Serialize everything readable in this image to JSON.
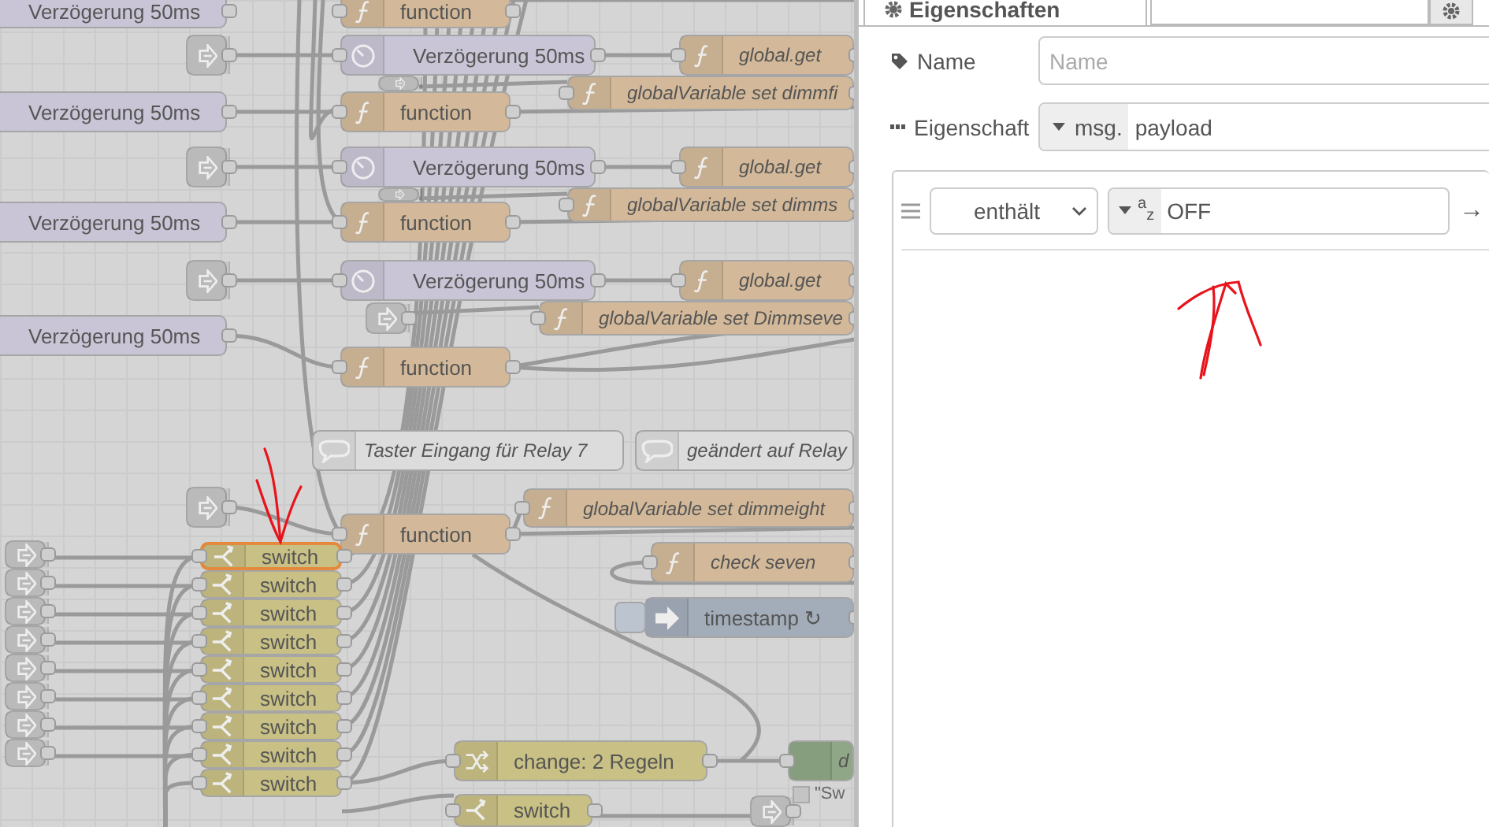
{
  "canvas": {
    "nodes": [
      {
        "kind": "delay",
        "label": "Verzögerung 50ms",
        "italic": false,
        "selected": false
      },
      {
        "kind": "function",
        "label": "function",
        "italic": false,
        "selected": false
      },
      {
        "kind": "link",
        "selected": false
      },
      {
        "kind": "delay",
        "label": "Verzögerung 50ms",
        "italic": false,
        "selected": false
      },
      {
        "kind": "function",
        "label": "global.get",
        "italic": true,
        "selected": false
      },
      {
        "kind": "link",
        "selected": false
      },
      {
        "kind": "function",
        "label": "globalVariable set dimmfi",
        "italic": true,
        "selected": false
      },
      {
        "kind": "delay",
        "label": "Verzögerung 50ms",
        "italic": false,
        "selected": false
      },
      {
        "kind": "function",
        "label": "function",
        "italic": false,
        "selected": false
      },
      {
        "kind": "link",
        "selected": false
      },
      {
        "kind": "delay",
        "label": "Verzögerung 50ms",
        "italic": false,
        "selected": false
      },
      {
        "kind": "function",
        "label": "global.get",
        "italic": true,
        "selected": false
      },
      {
        "kind": "link",
        "selected": false
      },
      {
        "kind": "function",
        "label": "globalVariable set dimms",
        "italic": true,
        "selected": false
      },
      {
        "kind": "delay",
        "label": "Verzögerung 50ms",
        "italic": false,
        "selected": false
      },
      {
        "kind": "function",
        "label": "function",
        "italic": false,
        "selected": false
      },
      {
        "kind": "link",
        "selected": false
      },
      {
        "kind": "delay",
        "label": "Verzögerung 50ms",
        "italic": false,
        "selected": false
      },
      {
        "kind": "function",
        "label": "global.get",
        "italic": true,
        "selected": false
      },
      {
        "kind": "link",
        "selected": false
      },
      {
        "kind": "function",
        "label": "globalVariable set Dimmseve",
        "italic": true,
        "selected": false
      },
      {
        "kind": "delay",
        "label": "Verzögerung 50ms",
        "italic": false,
        "selected": false
      },
      {
        "kind": "function",
        "label": "function",
        "italic": false,
        "selected": false
      },
      {
        "kind": "comment",
        "label": "Taster Eingang für Relay 7",
        "italic": true,
        "selected": false
      },
      {
        "kind": "comment",
        "label": "geändert auf Relay",
        "italic": true,
        "selected": false
      },
      {
        "kind": "link",
        "selected": false
      },
      {
        "kind": "function",
        "label": "globalVariable set dimmeight",
        "italic": true,
        "selected": false
      },
      {
        "kind": "function",
        "label": "function",
        "italic": false,
        "selected": false
      },
      {
        "kind": "function",
        "label": "check seven",
        "italic": true,
        "selected": false
      },
      {
        "kind": "inject",
        "label": "timestamp ↻",
        "italic": false,
        "selected": false
      },
      {
        "kind": "link",
        "selected": false
      },
      {
        "kind": "link",
        "selected": false
      },
      {
        "kind": "link",
        "selected": false
      },
      {
        "kind": "link",
        "selected": false
      },
      {
        "kind": "link",
        "selected": false
      },
      {
        "kind": "link",
        "selected": false
      },
      {
        "kind": "link",
        "selected": false
      },
      {
        "kind": "link",
        "selected": false
      },
      {
        "kind": "switch",
        "label": "switch",
        "italic": false,
        "selected": true
      },
      {
        "kind": "switch",
        "label": "switch",
        "italic": false,
        "selected": false
      },
      {
        "kind": "switch",
        "label": "switch",
        "italic": false,
        "selected": false
      },
      {
        "kind": "switch",
        "label": "switch",
        "italic": false,
        "selected": false
      },
      {
        "kind": "switch",
        "label": "switch",
        "italic": false,
        "selected": false
      },
      {
        "kind": "switch",
        "label": "switch",
        "italic": false,
        "selected": false
      },
      {
        "kind": "switch",
        "label": "switch",
        "italic": false,
        "selected": false
      },
      {
        "kind": "switch",
        "label": "switch",
        "italic": false,
        "selected": false
      },
      {
        "kind": "switch",
        "label": "switch",
        "italic": false,
        "selected": false
      },
      {
        "kind": "change",
        "label": "change: 2 Regeln",
        "italic": false,
        "selected": false
      },
      {
        "kind": "debug",
        "label": "d",
        "italic": true,
        "selected": false
      },
      {
        "kind": "switch",
        "label": "switch",
        "italic": false,
        "selected": false
      },
      {
        "kind": "link",
        "selected": false
      }
    ],
    "status_text": "\"Sw"
  },
  "panel": {
    "tab": "Eigenschaften",
    "fields": [
      {
        "kind": "text",
        "label": "Name",
        "placeholder": "Name"
      },
      {
        "kind": "typed",
        "label": "Eigenschaft",
        "prefix": "msg.",
        "value": "payload"
      }
    ],
    "rules": [
      {
        "operator": "enthält",
        "type": "$^{a}$$_{z}$",
        "value": "OFF",
        "arrow": "→"
      }
    ]
  }
}
